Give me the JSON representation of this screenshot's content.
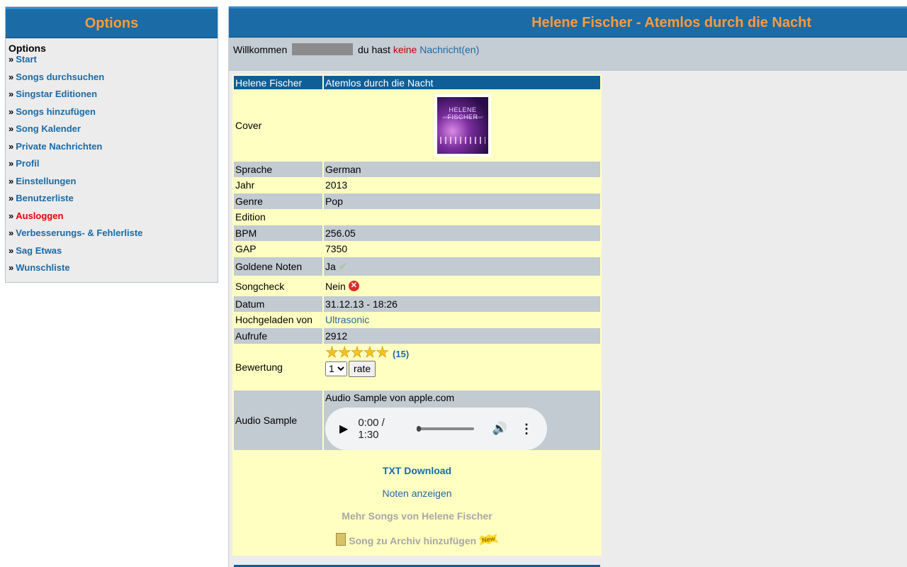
{
  "sidebar": {
    "header": "Options",
    "title": "Options",
    "items": [
      {
        "label": "Start"
      },
      {
        "label": "Songs durchsuchen"
      },
      {
        "label": "Singstar Editionen"
      },
      {
        "label": "Songs hinzufügen"
      },
      {
        "label": "Song Kalender"
      },
      {
        "label": "Private Nachrichten"
      },
      {
        "label": "Profil"
      },
      {
        "label": "Einstellungen"
      },
      {
        "label": "Benutzerliste"
      },
      {
        "label": "Ausloggen"
      },
      {
        "label": "Verbesserungs- & Fehlerliste"
      },
      {
        "label": "Sag Etwas"
      },
      {
        "label": "Wunschliste"
      }
    ],
    "bullet": "»"
  },
  "main": {
    "header": "Helene Fischer - Atemlos durch die Nacht",
    "welcome": {
      "prefix": "Willkommen",
      "middle": "du hast",
      "keine": "keine",
      "nachrichten": "Nachricht(en)"
    }
  },
  "song": {
    "artist": "Helene Fischer",
    "title": "Atemlos durch die Nacht",
    "cover_label": "Cover",
    "cover_text_title": "HELENE FISCHER",
    "cover_text_sub": "ATEMLOS DURCH DIE NACHT",
    "rows": {
      "sprache": {
        "label": "Sprache",
        "value": "German"
      },
      "jahr": {
        "label": "Jahr",
        "value": "2013"
      },
      "genre": {
        "label": "Genre",
        "value": "Pop"
      },
      "edition": {
        "label": "Edition",
        "value": ""
      },
      "bpm": {
        "label": "BPM",
        "value": "256.05"
      },
      "gap": {
        "label": "GAP",
        "value": "7350"
      },
      "goldene": {
        "label": "Goldene Noten",
        "value": "Ja"
      },
      "songcheck": {
        "label": "Songcheck",
        "value": "Nein"
      },
      "datum": {
        "label": "Datum",
        "value": "31.12.13 - 18:26"
      },
      "hochgeladen": {
        "label": "Hochgeladen von",
        "value": "Ultrasonic"
      },
      "aufrufe": {
        "label": "Aufrufe",
        "value": "2912"
      }
    },
    "bewertung": {
      "label": "Bewertung",
      "stars": "★★★★★",
      "count": "(15)",
      "select_value": "1",
      "rate_label": "rate"
    },
    "audio": {
      "label": "Audio Sample",
      "source_text": "Audio Sample von apple.com",
      "time": "0:00 / 1:30",
      "progress": 0
    },
    "links": {
      "txt_download": "TXT Download",
      "noten": "Noten anzeigen",
      "mehr_songs": "Mehr Songs von Helene Fischer",
      "archiv": "Song zu Archiv hinzufügen",
      "new_badge": "New"
    }
  },
  "colors": {
    "header_bg": "#1a6ba6",
    "header_text": "#ff9a3a",
    "link": "#1a6ba6",
    "logout": "#e00000",
    "table_bg": "#ffffc2",
    "row_gray": "#c2cad2"
  }
}
